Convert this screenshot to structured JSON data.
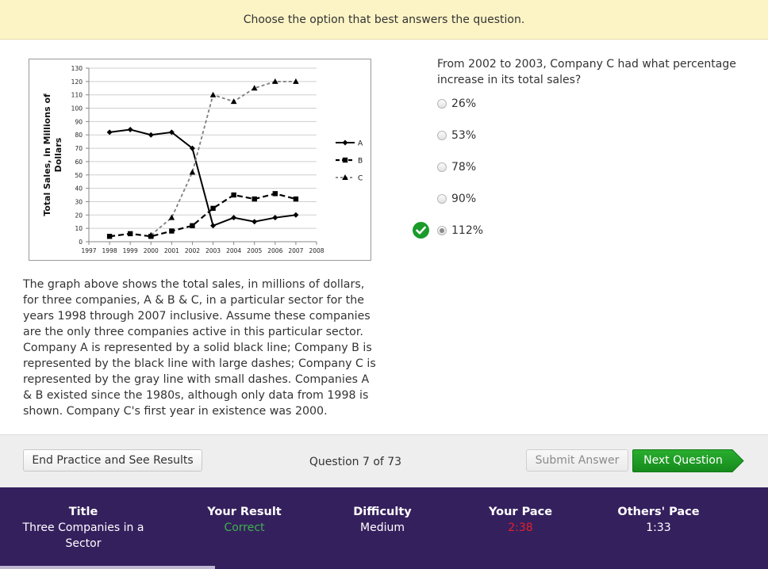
{
  "banner": {
    "text": "Choose the option that best answers the question."
  },
  "passage": "The graph above shows the total sales, in millions of dollars, for three companies, A & B & C, in a particular sector for the years 1998 through 2007 inclusive. Assume these companies are the only three companies active in this particular sector. Company A is represented by a solid black line; Company B is represented by the black line with large dashes; Company C is represented by the gray line with small dashes. Companies A & B existed since the 1980s, although only data from 1998 is shown. Company C's first year in existence was 2000.",
  "question": {
    "text": "From 2002 to 2003, Company C had what percentage increase in its total sales?",
    "options": [
      {
        "label": "26%",
        "selected": false
      },
      {
        "label": "53%",
        "selected": false
      },
      {
        "label": "78%",
        "selected": false
      },
      {
        "label": "90%",
        "selected": false
      },
      {
        "label": "112%",
        "selected": true
      }
    ],
    "result_icon": "check-circle-icon"
  },
  "actions": {
    "end_label": "End Practice and See Results",
    "question_counter": "Question 7 of 73",
    "submit_label": "Submit Answer",
    "next_label": "Next Question"
  },
  "footer": {
    "title_label": "Title",
    "title_value": "Three Companies in a Sector",
    "result_label": "Your Result",
    "result_value": "Correct",
    "difficulty_label": "Difficulty",
    "difficulty_value": "Medium",
    "pace_label": "Your Pace",
    "pace_value": "2:38",
    "others_label": "Others' Pace",
    "others_value": "1:33",
    "progress_fraction": 0.28
  },
  "colors": {
    "banner": "#fcf4c5",
    "footer": "#35205e",
    "next_button": "#1d9a24",
    "correct": "#3bb24a",
    "slow_pace": "#e2202a",
    "series_c": "#7f7f7f"
  },
  "chart_data": {
    "type": "line",
    "title": "",
    "ylabel": "Total Sales, in Millions of Dollars",
    "xlabel": "",
    "x": [
      1997,
      1998,
      1999,
      2000,
      2001,
      2002,
      2003,
      2004,
      2005,
      2006,
      2007,
      2008
    ],
    "xlim": [
      1997,
      2008
    ],
    "ylim": [
      0,
      130
    ],
    "yticks": [
      0,
      10,
      20,
      30,
      40,
      50,
      60,
      70,
      80,
      90,
      100,
      110,
      120,
      130
    ],
    "grid": true,
    "legend_position": "right",
    "series": [
      {
        "name": "A",
        "style": "solid",
        "marker": "diamond",
        "color": "#000000",
        "points": [
          [
            1998,
            82
          ],
          [
            1999,
            84
          ],
          [
            2000,
            80
          ],
          [
            2001,
            82
          ],
          [
            2002,
            70
          ],
          [
            2003,
            12
          ],
          [
            2004,
            18
          ],
          [
            2005,
            15
          ],
          [
            2006,
            18
          ],
          [
            2007,
            20
          ]
        ]
      },
      {
        "name": "B",
        "style": "dashed",
        "marker": "square",
        "color": "#000000",
        "points": [
          [
            1998,
            4
          ],
          [
            1999,
            6
          ],
          [
            2000,
            4
          ],
          [
            2001,
            8
          ],
          [
            2002,
            12
          ],
          [
            2003,
            25
          ],
          [
            2004,
            35
          ],
          [
            2005,
            32
          ],
          [
            2006,
            36
          ],
          [
            2007,
            32
          ]
        ]
      },
      {
        "name": "C",
        "style": "dotted",
        "marker": "triangle",
        "color": "#7f7f7f",
        "points": [
          [
            2000,
            5
          ],
          [
            2001,
            18
          ],
          [
            2002,
            52
          ],
          [
            2003,
            110
          ],
          [
            2004,
            105
          ],
          [
            2005,
            115
          ],
          [
            2006,
            120
          ],
          [
            2007,
            120
          ]
        ]
      }
    ]
  }
}
